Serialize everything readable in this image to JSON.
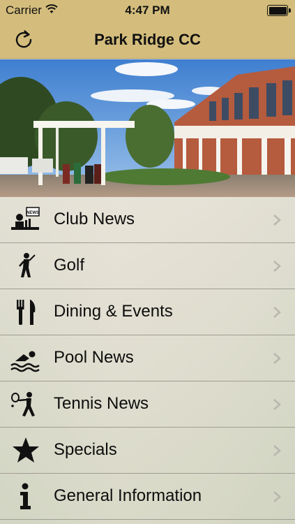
{
  "status_bar": {
    "carrier": "Carrier",
    "time": "4:47 PM"
  },
  "nav": {
    "title": "Park Ridge CC",
    "refresh_icon": "refresh-icon"
  },
  "hero": {
    "image": "clubhouse-photo"
  },
  "menu": {
    "items": [
      {
        "label": "Club News",
        "icon": "news-icon"
      },
      {
        "label": "Golf",
        "icon": "golfer-icon"
      },
      {
        "label": "Dining & Events",
        "icon": "fork-knife-icon"
      },
      {
        "label": "Pool News",
        "icon": "swimmer-icon"
      },
      {
        "label": "Tennis News",
        "icon": "tennis-player-icon"
      },
      {
        "label": "Specials",
        "icon": "star-icon"
      },
      {
        "label": "General Information",
        "icon": "info-icon"
      }
    ]
  },
  "colors": {
    "bar_gold": "#d4bd7c",
    "text": "#0d0d0d",
    "chevron": "#b9b6ad"
  }
}
